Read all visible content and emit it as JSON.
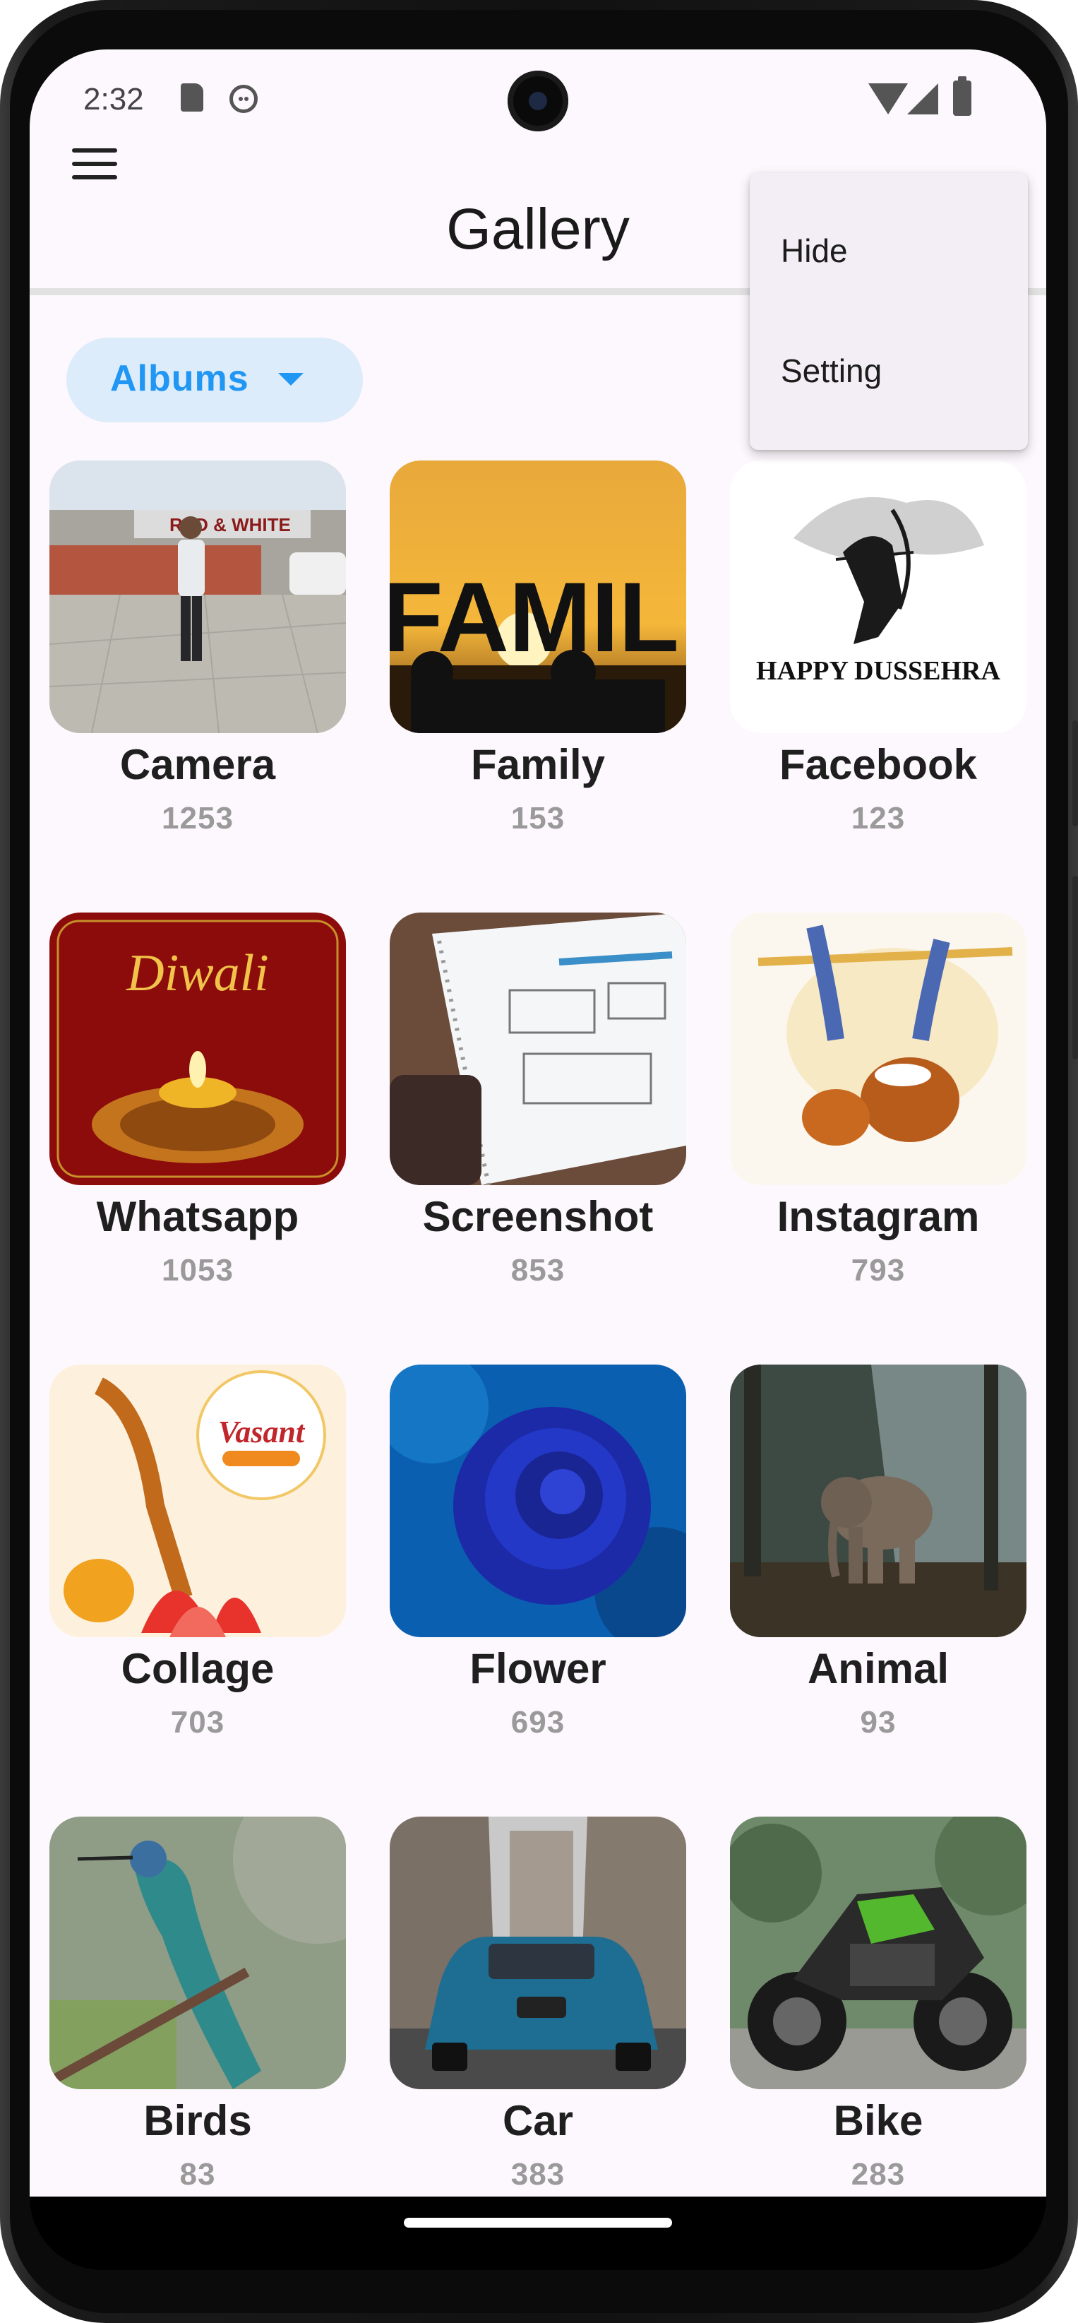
{
  "status_bar": {
    "time": "2:32"
  },
  "app_bar": {
    "title": "Gallery"
  },
  "filter": {
    "label": "Albums"
  },
  "popup_menu": {
    "items": [
      "Hide",
      "Setting"
    ]
  },
  "albums": [
    {
      "name": "Camera",
      "count": "1253",
      "thumbnail": "man-standing-outside-building"
    },
    {
      "name": "Family",
      "count": "153",
      "thumbnail": "family-letters-sunset",
      "overlay_text": "FAMIL"
    },
    {
      "name": "Facebook",
      "count": "123",
      "thumbnail": "happy-dussehra-greeting",
      "overlay_text": "HAPPY DUSSEHRA"
    },
    {
      "name": "Whatsapp",
      "count": "1053",
      "thumbnail": "happy-diwali-greeting",
      "overlay_text": "Diwali"
    },
    {
      "name": "Screenshot",
      "count": "853",
      "thumbnail": "sketch-notebook-wireframe"
    },
    {
      "name": "Instagram",
      "count": "793",
      "thumbnail": "janmashtami-flute-pots"
    },
    {
      "name": "Collage",
      "count": "703",
      "thumbnail": "vasant-panchami-veena",
      "overlay_text": "Vasant"
    },
    {
      "name": "Flower",
      "count": "693",
      "thumbnail": "blue-rose"
    },
    {
      "name": "Animal",
      "count": "93",
      "thumbnail": "elephant-in-forest"
    },
    {
      "name": "Birds",
      "count": "83",
      "thumbnail": "hummingbird-on-branch"
    },
    {
      "name": "Car",
      "count": "383",
      "thumbnail": "blue-bmw-city-street"
    },
    {
      "name": "Bike",
      "count": "283",
      "thumbnail": "green-black-sport-motorcycle"
    }
  ]
}
